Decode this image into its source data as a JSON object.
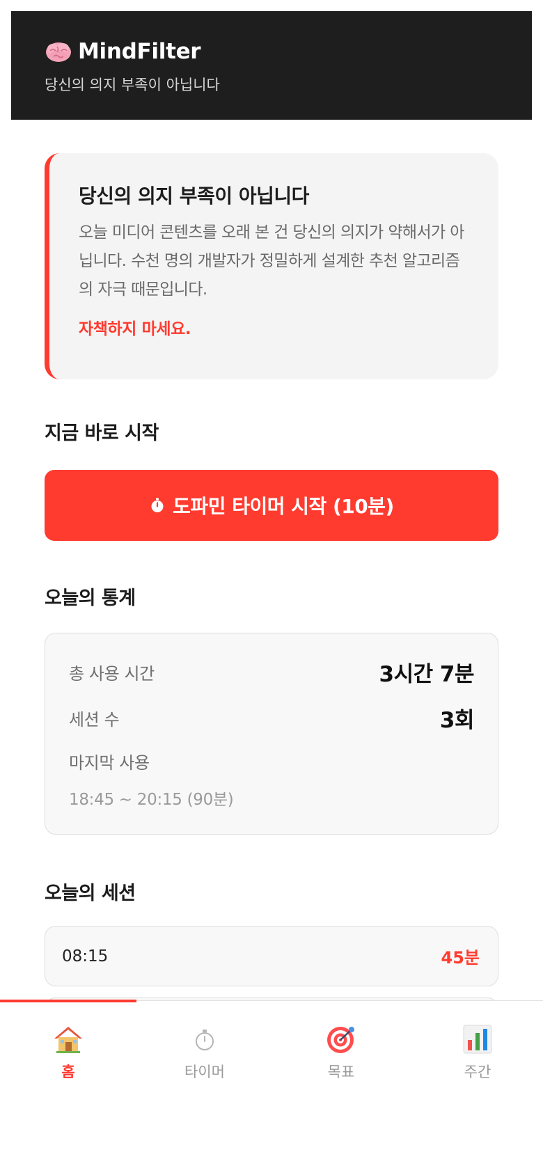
{
  "header": {
    "brand_icon": "brain-icon",
    "title": "MindFilter",
    "subtitle": "당신의 의지 부족이 아닙니다"
  },
  "notice": {
    "title": "당신의 의지 부족이 아닙니다",
    "body": "오늘 미디어 콘텐츠를 오래 본 건 당신의 의지가 약해서가 아닙니다. 수천 명의 개발자가 정밀하게 설계한 추천 알고리즘의 자극 때문입니다.",
    "emphasis": "자책하지 마세요."
  },
  "start": {
    "section_title": "지금 바로 시작",
    "button_icon": "stopwatch-icon",
    "button_label": "도파민 타이머 시작 (10분)"
  },
  "stats": {
    "section_title": "오늘의 통계",
    "total_label": "총 사용 시간",
    "total_value": "3시간 7분",
    "sessions_label": "세션 수",
    "sessions_value": "3회",
    "last_label": "마지막 사용",
    "last_range": "18:45 ~ 20:15 (90분)"
  },
  "sessions": {
    "section_title": "오늘의 세션",
    "items": [
      {
        "time": "08:15",
        "duration": "45분"
      },
      {
        "time": "",
        "duration": ""
      }
    ]
  },
  "tabbar": {
    "active_tab": "홈",
    "tabs": [
      {
        "label": "홈",
        "icon": "house-icon"
      },
      {
        "label": "타이머",
        "icon": "stopwatch-icon"
      },
      {
        "label": "목표",
        "icon": "target-icon"
      },
      {
        "label": "주간",
        "icon": "bar-chart-icon"
      }
    ]
  },
  "colors": {
    "accent": "#ff3b30",
    "header_bg": "#1e1e1e",
    "card_bg": "#f4f4f4"
  }
}
